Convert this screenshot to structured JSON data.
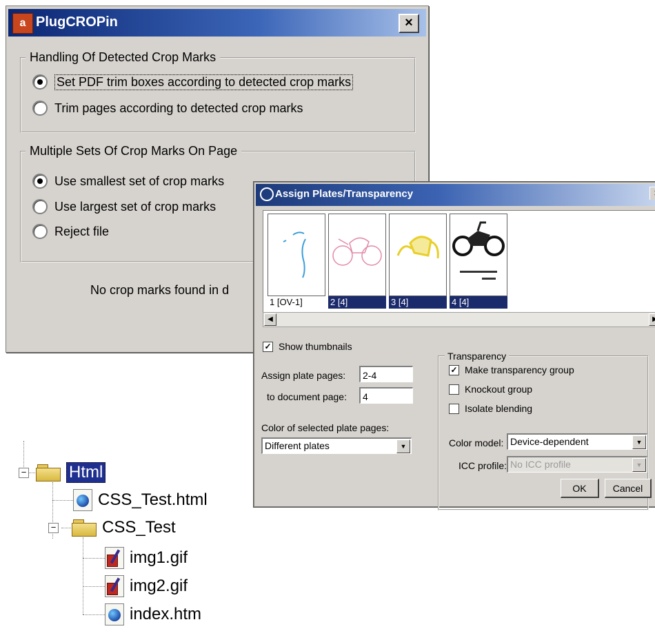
{
  "plugcropin": {
    "title": "PlugCROPin",
    "close": "×",
    "app_icon": "plugcropin-app-icon",
    "group1": {
      "legend": "Handling Of Detected Crop Marks",
      "options": [
        {
          "label": "Set PDF trim boxes according to detected crop marks",
          "selected": true
        },
        {
          "label": "Trim pages according to detected crop marks",
          "selected": false
        }
      ]
    },
    "group2": {
      "legend": "Multiple Sets Of Crop Marks On Page",
      "options": [
        {
          "label": "Use smallest set of crop marks",
          "selected": true
        },
        {
          "label": "Use largest set of crop marks",
          "selected": false
        },
        {
          "label": "Reject file",
          "selected": false
        }
      ]
    },
    "status": "No crop marks found in d"
  },
  "assign_plates": {
    "title": "Assign Plates/Transparency",
    "close": "×",
    "thumbnails": [
      {
        "caption": "1 [OV-1]",
        "selected": false
      },
      {
        "caption": "2 [4]",
        "selected": true
      },
      {
        "caption": "3 [4]",
        "selected": true
      },
      {
        "caption": "4 [4]",
        "selected": true
      }
    ],
    "show_thumbnails": {
      "label": "Show thumbnails",
      "checked": true
    },
    "assign_plate_pages": {
      "label": "Assign plate pages:",
      "value": "2-4"
    },
    "to_document_page": {
      "label": "to document page:",
      "value": "4"
    },
    "color_of_selected": {
      "label": "Color of selected plate pages:",
      "value": "Different plates"
    },
    "transparency": {
      "legend": "Transparency",
      "make_group": {
        "label": "Make transparency group",
        "checked": true
      },
      "knockout": {
        "label": "Knockout group",
        "checked": false
      },
      "isolate": {
        "label": "Isolate blending",
        "checked": false
      },
      "color_model": {
        "label": "Color model:",
        "value": "Device-dependent"
      },
      "icc_profile": {
        "label": "ICC profile:",
        "value": "No ICC profile",
        "enabled": false
      }
    },
    "ok": "OK",
    "cancel": "Cancel"
  },
  "tree": {
    "root": {
      "label": "Html",
      "selected": true
    },
    "items": [
      {
        "label": "CSS_Test.html",
        "icon": "html-document-icon"
      },
      {
        "label": "CSS_Test",
        "icon": "folder-icon"
      },
      {
        "label": "img1.gif",
        "icon": "gif-image-icon"
      },
      {
        "label": "img2.gif",
        "icon": "gif-image-icon"
      },
      {
        "label": "index.htm",
        "icon": "html-document-icon"
      }
    ]
  }
}
